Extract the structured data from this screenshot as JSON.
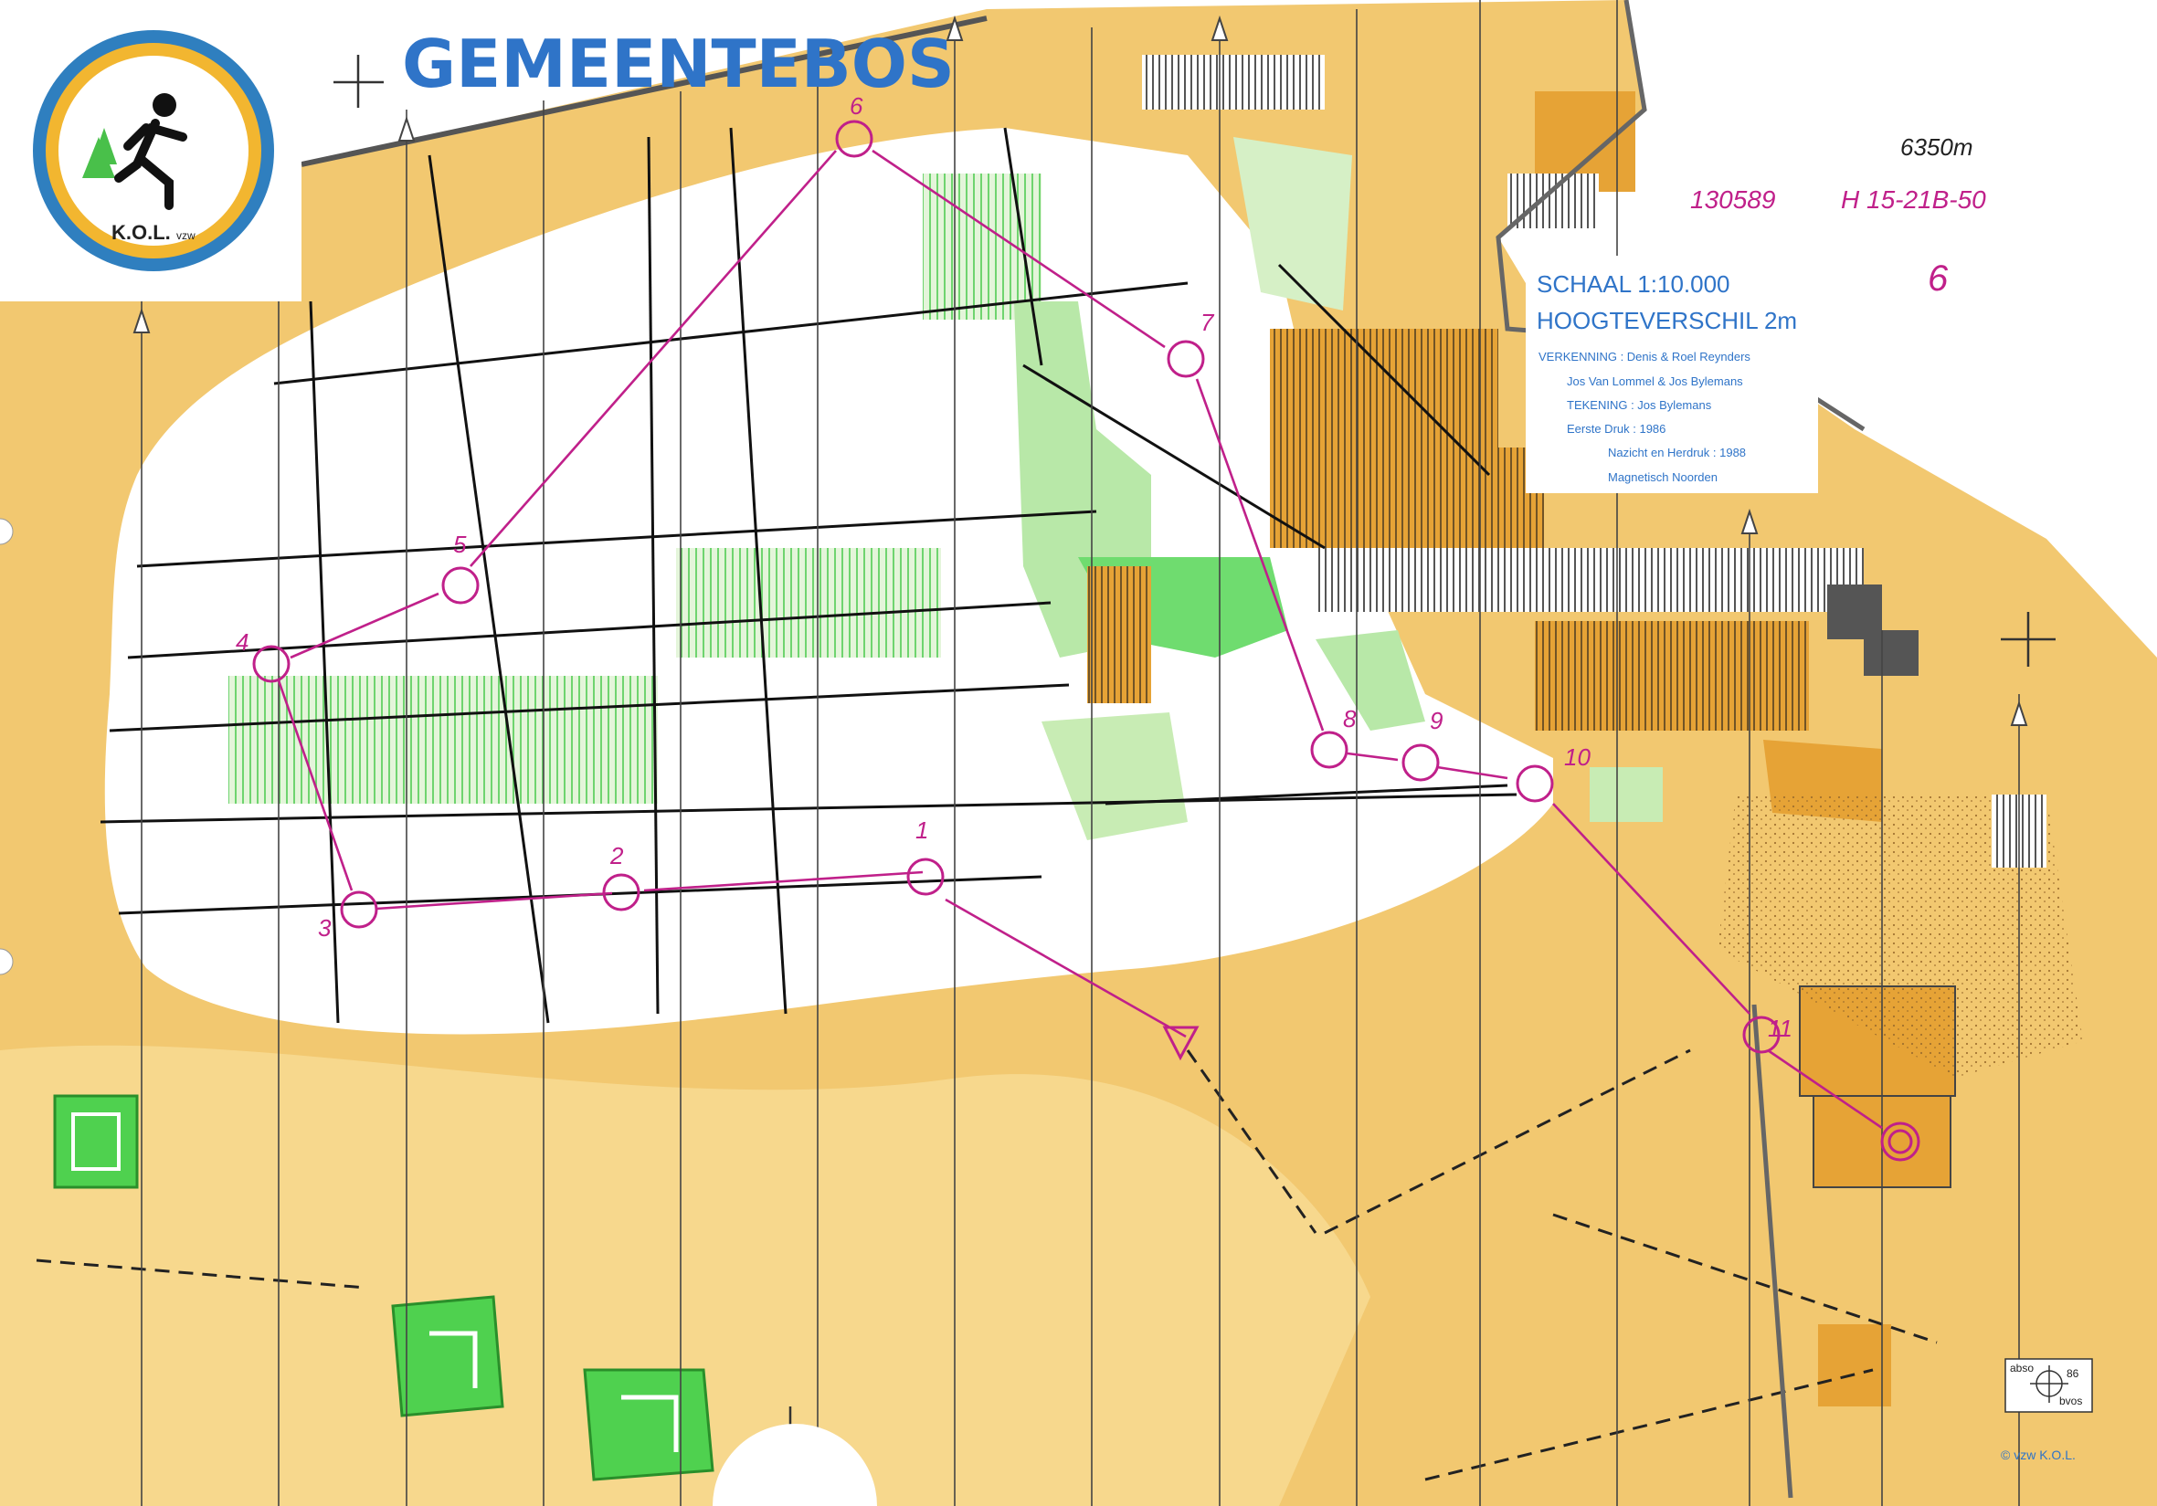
{
  "map": {
    "title": "GEMEENTEBOS",
    "logo_text": "K.O.L.",
    "logo_suffix": "vzw",
    "handwritten_distance": "6350m",
    "event_code": "130589",
    "category": "H 15-21B-50",
    "course_number": "6",
    "scale": "SCHAAL 1:10.000",
    "contour": "HOOGTEVERSCHIL 2m",
    "credits": [
      "VERKENNING : Denis & Roel Reynders",
      "Jos Van Lommel & Jos Bylemans",
      "TEKENING : Jos Bylemans",
      "Eerste Druk : 1986",
      "Nazicht en Herdruk : 1988",
      "Magnetisch Noorden"
    ],
    "corner_labels": {
      "abso": "abso",
      "num": "86",
      "bvos": "bvos"
    },
    "copyright": "© vzw K.O.L.",
    "controls": [
      {
        "label": "1"
      },
      {
        "label": "2"
      },
      {
        "label": "3"
      },
      {
        "label": "4"
      },
      {
        "label": "5"
      },
      {
        "label": "6"
      },
      {
        "label": "7"
      },
      {
        "label": "8"
      },
      {
        "label": "9"
      },
      {
        "label": "10"
      },
      {
        "label": "11"
      }
    ],
    "colors": {
      "open_land": "#f2c870",
      "rough_open": "#f7dc95",
      "forest_white": "#ffffff",
      "green_light": "#c8ecb4",
      "green_dark": "#4fd14f",
      "course_magenta": "#c0208a",
      "title_blue": "#2f74c8",
      "orange_field": "#e6a336",
      "grey_build": "#8a8a8a"
    }
  }
}
